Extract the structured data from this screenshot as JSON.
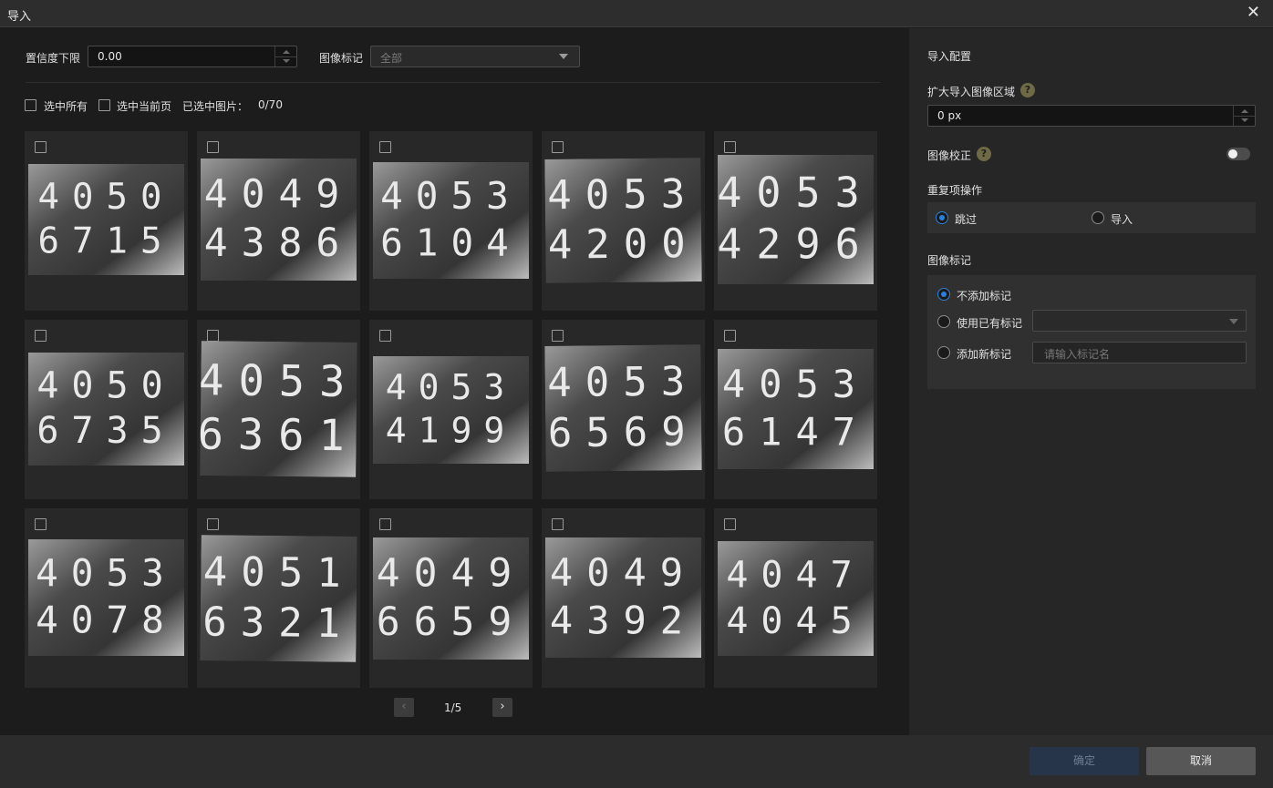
{
  "window": {
    "title": "导入",
    "close_icon": "close-icon"
  },
  "filters": {
    "confidence_label": "置信度下限",
    "confidence_value": "0.00",
    "tag_label": "图像标记",
    "tag_value": "全部"
  },
  "selection": {
    "select_all_label": "选中所有",
    "select_page_label": "选中当前页",
    "selected_label": "已选中图片：",
    "selected_count": "0/70"
  },
  "images": [
    {
      "line1": "4050",
      "line2": "6715",
      "checked": false
    },
    {
      "line1": "4049",
      "line2": "4386",
      "checked": false
    },
    {
      "line1": "4053",
      "line2": "6104",
      "checked": false
    },
    {
      "line1": "4053",
      "line2": "4200",
      "checked": false
    },
    {
      "line1": "4053",
      "line2": "4296",
      "checked": false
    },
    {
      "line1": "4050",
      "line2": "6735",
      "checked": false
    },
    {
      "line1": "4053",
      "line2": "6361",
      "checked": false
    },
    {
      "line1": "4053",
      "line2": "4199",
      "checked": false
    },
    {
      "line1": "4053",
      "line2": "6569",
      "checked": false
    },
    {
      "line1": "4053",
      "line2": "6147",
      "checked": false
    },
    {
      "line1": "4053",
      "line2": "4078",
      "checked": false
    },
    {
      "line1": "4051",
      "line2": "6321",
      "checked": false
    },
    {
      "line1": "4049",
      "line2": "6659",
      "checked": false
    },
    {
      "line1": "4049",
      "line2": "4392",
      "checked": false
    },
    {
      "line1": "4047",
      "line2": "4045",
      "checked": false
    }
  ],
  "pager": {
    "text": "1/5",
    "prev_icon": "chevron-left-icon",
    "next_icon": "chevron-right-icon"
  },
  "config": {
    "title": "导入配置",
    "expand_label": "扩大导入图像区域",
    "expand_value": "0 px",
    "correction_label": "图像校正",
    "correction_on": false,
    "duplicate_label": "重复项操作",
    "duplicate_skip": "跳过",
    "duplicate_import": "导入",
    "duplicate_selected": "skip",
    "tag_section_label": "图像标记",
    "tag_none": "不添加标记",
    "tag_existing": "使用已有标记",
    "tag_new": "添加新标记",
    "tag_new_placeholder": "请输入标记名",
    "tag_selected": "none"
  },
  "footer": {
    "ok_label": "确定",
    "cancel_label": "取消"
  },
  "colors": {
    "accent": "#2f7fd6",
    "ok_bg": "#27354a",
    "cancel_bg": "#575757"
  }
}
